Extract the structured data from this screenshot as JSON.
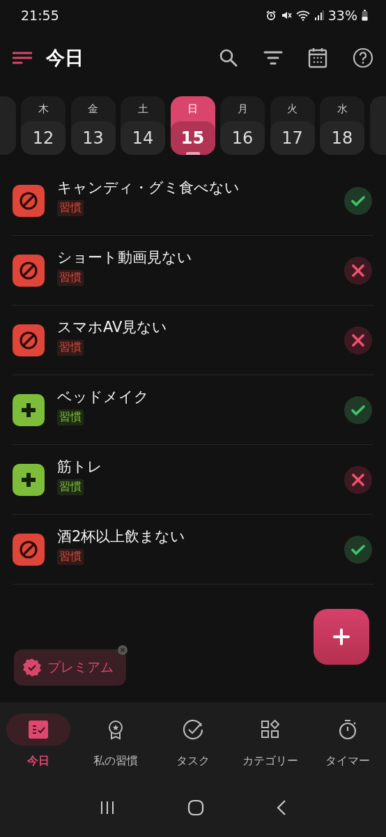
{
  "status_bar": {
    "time": "21:55",
    "battery": "33%"
  },
  "header": {
    "title": "今日"
  },
  "days": [
    {
      "weekday": "木",
      "date": "12",
      "selected": false
    },
    {
      "weekday": "金",
      "date": "13",
      "selected": false
    },
    {
      "weekday": "土",
      "date": "14",
      "selected": false
    },
    {
      "weekday": "日",
      "date": "15",
      "selected": true
    },
    {
      "weekday": "月",
      "date": "16",
      "selected": false
    },
    {
      "weekday": "火",
      "date": "17",
      "selected": false
    },
    {
      "weekday": "水",
      "date": "18",
      "selected": false
    }
  ],
  "habits": [
    {
      "name": "キャンディ・グミ食べない",
      "tag": "習慣",
      "kind": "avoid",
      "done": true
    },
    {
      "name": "ショート動画見ない",
      "tag": "習慣",
      "kind": "avoid",
      "done": false
    },
    {
      "name": "スマホAV見ない",
      "tag": "習慣",
      "kind": "avoid",
      "done": false
    },
    {
      "name": "ベッドメイク",
      "tag": "習慣",
      "kind": "build",
      "done": true
    },
    {
      "name": "筋トレ",
      "tag": "習慣",
      "kind": "build",
      "done": false
    },
    {
      "name": "酒2杯以上飲まない",
      "tag": "習慣",
      "kind": "avoid",
      "done": true
    }
  ],
  "premium": {
    "label": "プレミアム"
  },
  "nav": [
    {
      "label": "今日",
      "selected": true
    },
    {
      "label": "私の習慣",
      "selected": false
    },
    {
      "label": "タスク",
      "selected": false
    },
    {
      "label": "カテゴリー",
      "selected": false
    },
    {
      "label": "タイマー",
      "selected": false
    }
  ]
}
